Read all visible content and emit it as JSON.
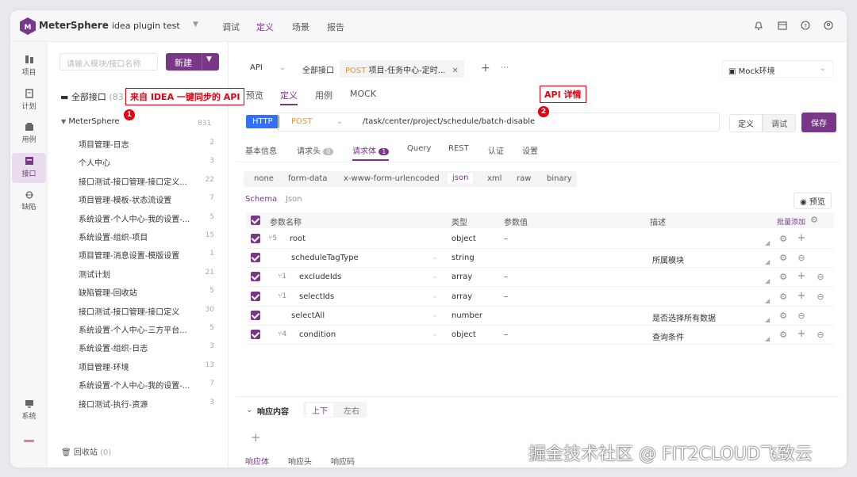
{
  "app": {
    "brand": "MeterSphere",
    "project": "idea plugin test"
  },
  "topnav": [
    {
      "label": "调试"
    },
    {
      "label": "定义"
    },
    {
      "label": "场景"
    },
    {
      "label": "报告"
    }
  ],
  "leftnav": [
    {
      "label": "项目",
      "icon": "project-icon"
    },
    {
      "label": "计划",
      "icon": "plan-icon"
    },
    {
      "label": "用例",
      "icon": "case-icon"
    },
    {
      "label": "接口",
      "icon": "api-icon"
    },
    {
      "label": "缺陷",
      "icon": "bug-icon"
    },
    {
      "label": "系统",
      "icon": "system-icon"
    }
  ],
  "tree": {
    "search_placeholder": "请输入模块/接口名称",
    "new_label": "新建",
    "all_label": "全部接口",
    "all_count": "(831)",
    "root_label": "MeterSphere",
    "root_count": "831",
    "items": [
      {
        "label": "项目管理-日志",
        "count": "2"
      },
      {
        "label": "个人中心",
        "count": "3"
      },
      {
        "label": "接口测试-接口管理-接口定义...",
        "count": "22"
      },
      {
        "label": "项目管理-模板-状态流设置",
        "count": "7"
      },
      {
        "label": "系统设置-个人中心-我的设置-...",
        "count": "5"
      },
      {
        "label": "系统设置-组织-项目",
        "count": "15"
      },
      {
        "label": "项目管理-消息设置-模版设置",
        "count": "1"
      },
      {
        "label": "测试计划",
        "count": "21"
      },
      {
        "label": "缺陷管理-回收站",
        "count": "5"
      },
      {
        "label": "接口测试-接口管理-接口定义",
        "count": "30"
      },
      {
        "label": "系统设置-个人中心-三方平台...",
        "count": "5"
      },
      {
        "label": "系统设置-组织-日志",
        "count": "3"
      },
      {
        "label": "项目管理-环境",
        "count": "13"
      },
      {
        "label": "系统设置-个人中心-我的设置-...",
        "count": "7"
      },
      {
        "label": "接口测试-执行-资源",
        "count": "3"
      }
    ],
    "recycle_label": "回收站",
    "recycle_count": "(0)"
  },
  "annotations": {
    "a1": "来自 IDEA 一键同步的 API",
    "a2": "API 详情",
    "b1": "1",
    "b2": "2"
  },
  "api": {
    "type_select": "API",
    "tab_all": "全部接口",
    "tab_method": "POST",
    "tab_title": "项目-任务中心-定时...",
    "env": "Mock环境",
    "views": [
      "预览",
      "定义",
      "用例",
      "MOCK"
    ],
    "protocol": "HTTP",
    "method": "POST",
    "url": "/task/center/project/schedule/batch-disable",
    "mode_define": "定义",
    "mode_debug": "调试",
    "save": "保存",
    "req_tabs": [
      "基本信息",
      "请求头",
      "请求体",
      "Query",
      "REST",
      "认证",
      "设置"
    ],
    "req_head_count": "0",
    "req_body_count": "1",
    "body_types": [
      "none",
      "form-data",
      "x-www-form-urlencoded",
      "json",
      "xml",
      "raw",
      "binary"
    ],
    "schema": "Schema",
    "json": "Json",
    "preview": "预览"
  },
  "table": {
    "headers": {
      "name": "参数名称",
      "type": "类型",
      "value": "参数值",
      "desc": "描述",
      "batch": "批量添加"
    },
    "rows": [
      {
        "name": "root",
        "children": "5",
        "type": "object",
        "value": "–",
        "desc": ""
      },
      {
        "name": "scheduleTagType",
        "children": "",
        "type": "string",
        "value": "",
        "desc": "所属模块"
      },
      {
        "name": "excludeIds",
        "children": "1",
        "type": "array",
        "value": "–",
        "desc": ""
      },
      {
        "name": "selectIds",
        "children": "1",
        "type": "array",
        "value": "–",
        "desc": ""
      },
      {
        "name": "selectAll",
        "children": "",
        "type": "number",
        "value": "",
        "desc": "是否选择所有数据"
      },
      {
        "name": "condition",
        "children": "4",
        "type": "object",
        "value": "–",
        "desc": "查询条件"
      }
    ]
  },
  "response": {
    "title": "响应内容",
    "layout_a": "上下",
    "layout_b": "左右",
    "tabs": [
      "响应体",
      "响应头",
      "响应码"
    ]
  },
  "watermark": "掘金技术社区 @ FIT2CLOUD飞致云"
}
